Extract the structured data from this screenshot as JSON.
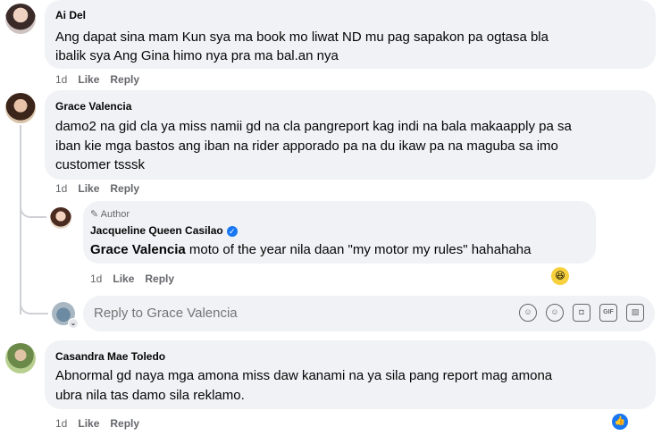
{
  "comments": [
    {
      "author": "Ai Del",
      "lines": [
        "Ang dapat sina mam Kun sya ma book mo liwat ND mu pag sapakon pa ogtasa bla",
        "ibalik sya Ang Gina himo nya pra ma bal.an nya"
      ],
      "time": "1d",
      "like": "Like",
      "reply": "Reply"
    },
    {
      "author": "Grace Valencia",
      "lines": [
        "damo2 na gid cla ya miss namii gd na cla pangreport kag indi na bala makaapply pa sa",
        "iban kie mga bastos ang iban na rider apporado pa na du ikaw pa na maguba sa imo",
        "customer tsssk"
      ],
      "time": "1d",
      "like": "Like",
      "reply": "Reply",
      "replies": [
        {
          "badge": "Author",
          "author": "Jacqueline Queen Casilao",
          "mention": "Grace Valencia",
          "text": " moto of the year nila daan \"my motor my rules\" hahahaha",
          "time": "1d",
          "like": "Like",
          "reply": "Reply",
          "reaction": "😆"
        }
      ]
    },
    {
      "author": "Casandra Mae Toledo",
      "lines": [
        "Abnormal gd naya mga amona miss daw kanami na ya sila pang report mag amona",
        "ubra nila tas damo sila reklamo."
      ],
      "time": "1d",
      "like": "Like",
      "reply": "Reply",
      "reaction": "👍"
    }
  ],
  "reply_box": {
    "placeholder": "Reply to Grace Valencia",
    "tools": [
      "avatar-sticker-icon",
      "emoji-icon",
      "camera-icon",
      "gif-icon",
      "sticker-icon"
    ],
    "tool_glyphs": [
      "☺",
      "☺",
      "◘",
      "GIF",
      "▧"
    ]
  }
}
